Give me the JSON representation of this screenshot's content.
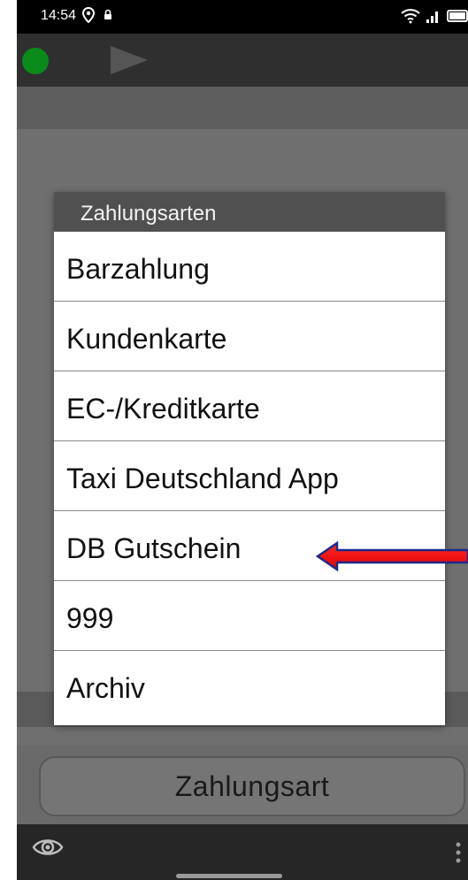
{
  "status_bar": {
    "time": "14:54",
    "icons": [
      "location-icon",
      "lock-icon",
      "wifi-icon",
      "signal-icon",
      "battery-icon"
    ]
  },
  "toolbar": {
    "status_color": "#0a8a1a",
    "play_icon": "play-icon"
  },
  "dialog": {
    "title": "Zahlungsarten",
    "items": [
      "Barzahlung",
      "Kundenkarte",
      "EC-/Kreditkarte",
      "Taxi Deutschland App",
      "DB Gutschein",
      "999",
      "Archiv"
    ]
  },
  "annotation": {
    "arrow_color": "#ff0000",
    "points_to": "DB Gutschein"
  },
  "bottom_button": {
    "label": "Zahlungsart"
  },
  "nav_bar": {
    "icons": [
      "eye-icon",
      "more-vertical-icon"
    ]
  }
}
